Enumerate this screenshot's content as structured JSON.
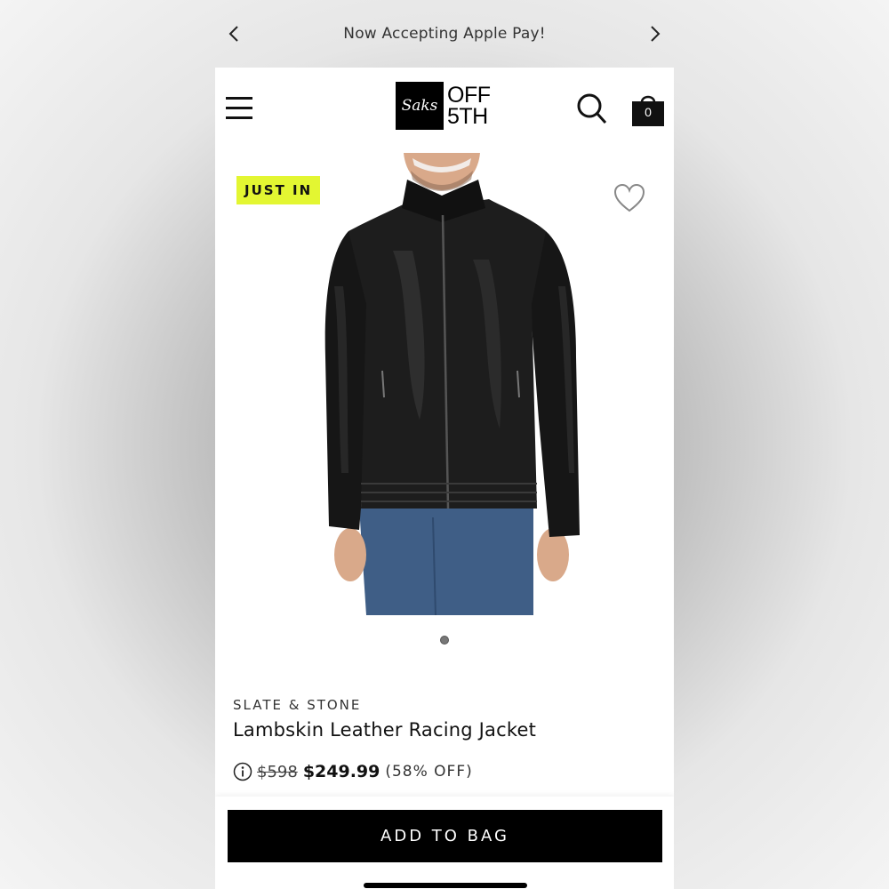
{
  "promo": {
    "text": "Now Accepting Apple Pay!",
    "prev_icon": "chevron-left-icon",
    "next_icon": "chevron-right-icon"
  },
  "header": {
    "menu_icon": "hamburger-menu-icon",
    "logo_script": "Saks",
    "logo_line1": "OFF",
    "logo_line2": "5TH",
    "search_icon": "search-icon",
    "bag_icon": "shopping-bag-icon",
    "bag_count": "0"
  },
  "product": {
    "badge": "JUST IN",
    "badge_color": "#e3f632",
    "wishlist_icon": "heart-icon",
    "image_subject": "black leather jacket",
    "carousel_total": 1,
    "carousel_active": 1,
    "brand": "SLATE & STONE",
    "name": "Lambskin Leather Racing Jacket",
    "info_icon": "info-icon",
    "original_price": "$598",
    "sale_price": "$249.99",
    "discount": "(58% OFF)"
  },
  "cta": {
    "add_to_bag": "ADD TO BAG"
  }
}
